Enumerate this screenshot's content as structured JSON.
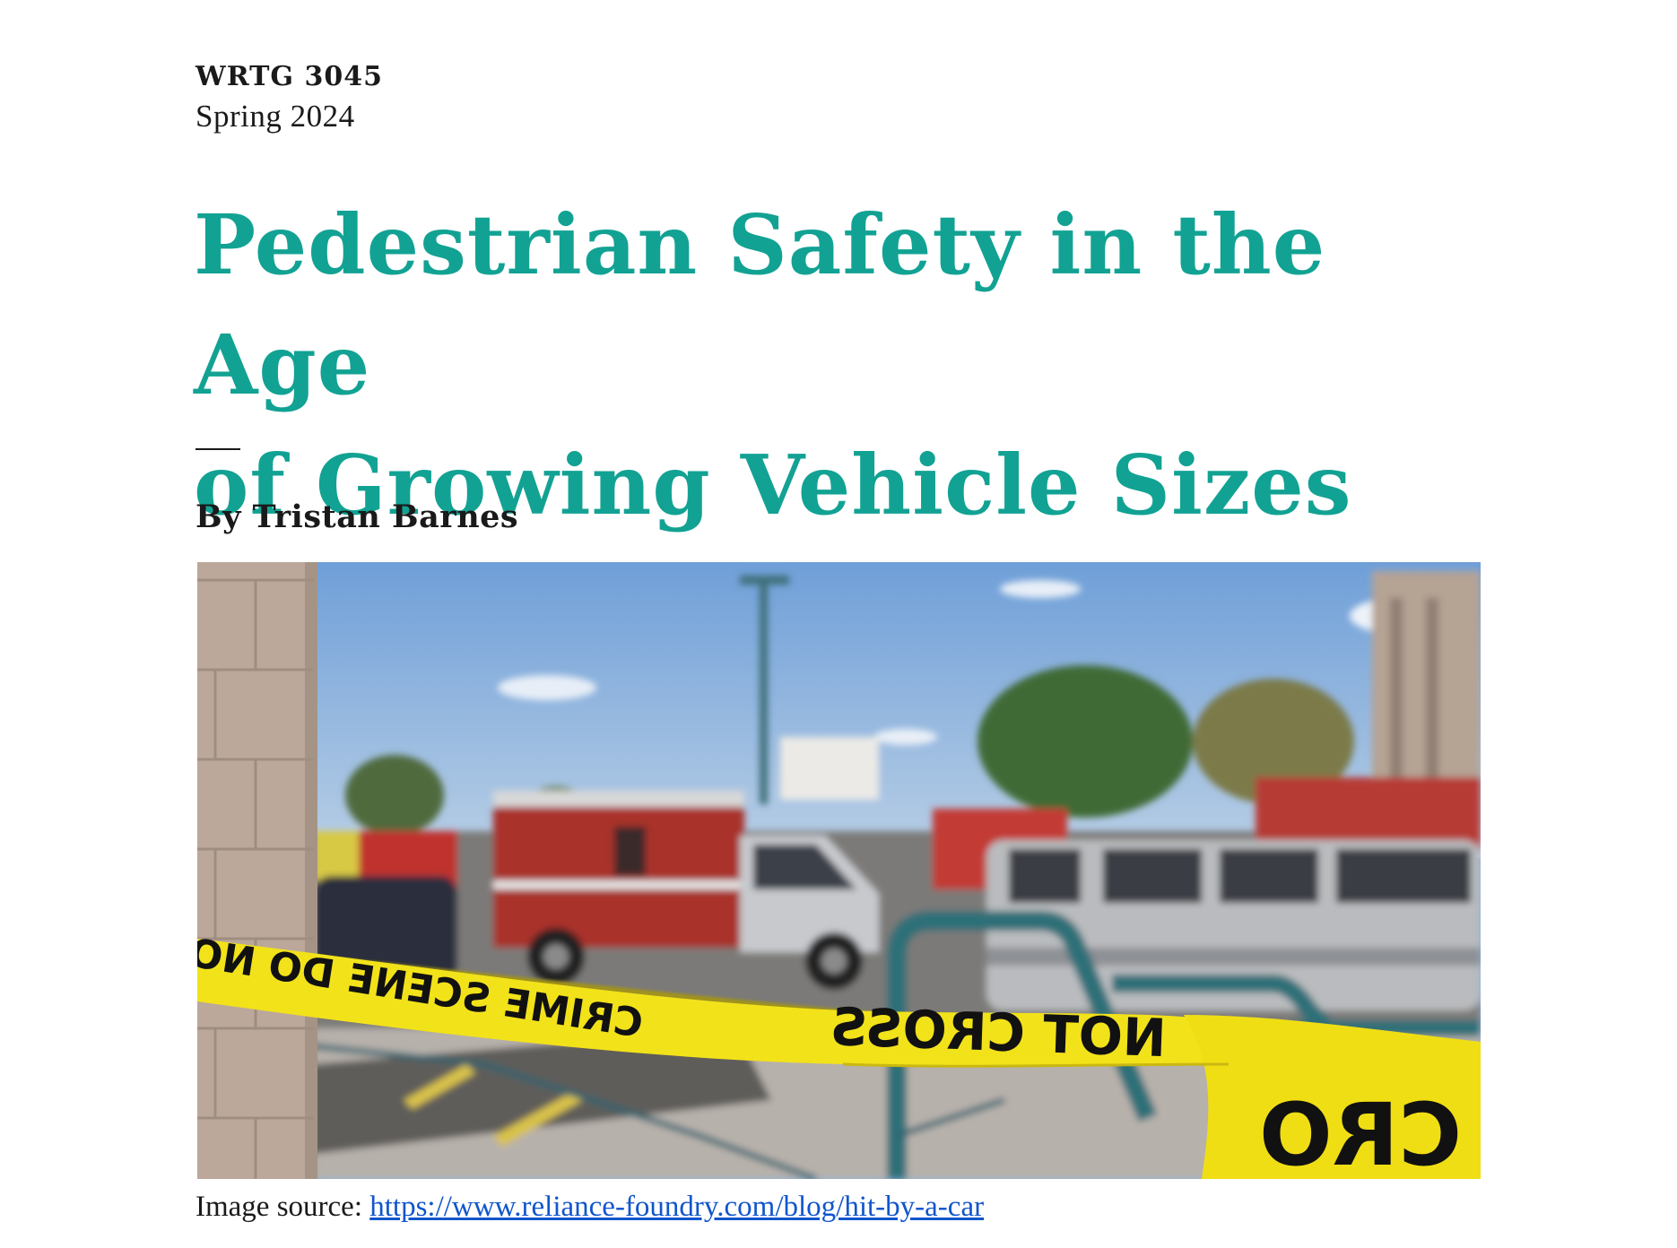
{
  "header": {
    "course_code": "WRTG 3045",
    "term": "Spring 2024"
  },
  "article": {
    "title_line1": "Pedestrian Safety in the Age",
    "title_line2": "of Growing Vehicle Sizes",
    "byline": "By Tristan Barnes"
  },
  "figure": {
    "tape_text_left": "CRIME SCENE DO NOT CROSS",
    "tape_text_right": "NOT CROSS",
    "tape_text_corner": "CRO",
    "caption_prefix": "Image source:",
    "caption_link": "https://www.reliance-foundry.com/blog/hit-by-a-car"
  },
  "colors": {
    "title": "#12a293",
    "text": "#1a1a1a",
    "link": "#1155cc",
    "tape": "#f2e21a"
  }
}
